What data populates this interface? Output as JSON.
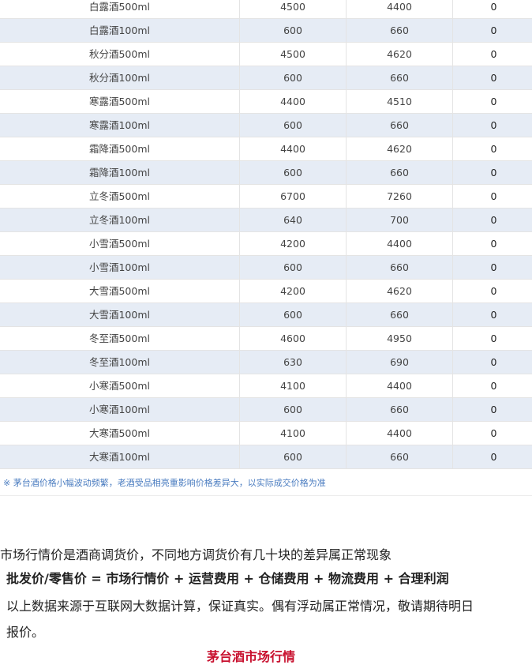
{
  "table": {
    "rows": [
      {
        "name": "白露酒500ml",
        "v1": "4500",
        "v2": "4400",
        "v3": "0"
      },
      {
        "name": "白露酒100ml",
        "v1": "600",
        "v2": "660",
        "v3": "0"
      },
      {
        "name": "秋分酒500ml",
        "v1": "4500",
        "v2": "4620",
        "v3": "0"
      },
      {
        "name": "秋分酒100ml",
        "v1": "600",
        "v2": "660",
        "v3": "0"
      },
      {
        "name": "寒露酒500ml",
        "v1": "4400",
        "v2": "4510",
        "v3": "0"
      },
      {
        "name": "寒露酒100ml",
        "v1": "600",
        "v2": "660",
        "v3": "0"
      },
      {
        "name": "霜降酒500ml",
        "v1": "4400",
        "v2": "4620",
        "v3": "0"
      },
      {
        "name": "霜降酒100ml",
        "v1": "600",
        "v2": "660",
        "v3": "0"
      },
      {
        "name": "立冬酒500ml",
        "v1": "6700",
        "v2": "7260",
        "v3": "0"
      },
      {
        "name": "立冬酒100ml",
        "v1": "640",
        "v2": "700",
        "v3": "0"
      },
      {
        "name": "小雪酒500ml",
        "v1": "4200",
        "v2": "4400",
        "v3": "0"
      },
      {
        "name": "小雪酒100ml",
        "v1": "600",
        "v2": "660",
        "v3": "0"
      },
      {
        "name": "大雪酒500ml",
        "v1": "4200",
        "v2": "4620",
        "v3": "0"
      },
      {
        "name": "大雪酒100ml",
        "v1": "600",
        "v2": "660",
        "v3": "0"
      },
      {
        "name": "冬至酒500ml",
        "v1": "4600",
        "v2": "4950",
        "v3": "0"
      },
      {
        "name": "冬至酒100ml",
        "v1": "630",
        "v2": "690",
        "v3": "0"
      },
      {
        "name": "小寒酒500ml",
        "v1": "4100",
        "v2": "4400",
        "v3": "0"
      },
      {
        "name": "小寒酒100ml",
        "v1": "600",
        "v2": "660",
        "v3": "0"
      },
      {
        "name": "大寒酒500ml",
        "v1": "4100",
        "v2": "4400",
        "v3": "0"
      },
      {
        "name": "大寒酒100ml",
        "v1": "600",
        "v2": "660",
        "v3": "0"
      }
    ]
  },
  "note": "※ 茅台酒价格小幅波动频繁，老酒受品相亮重影响价格差异大，以实际成交价格为准",
  "article": {
    "p1": "市场行情价是酒商调货价，不同地方调货价有几十块的差异属正常现象",
    "p2": "批发价/零售价 = 市场行情价 + 运营费用 + 仓储费用 + 物流费用 + 合理利润",
    "p3": "以上数据来源于互联网大数据计算，保证真实。偶有浮动属正常情况，敬请期待明日",
    "p4": "报价。",
    "footer_title": "茅台酒市场行情"
  }
}
